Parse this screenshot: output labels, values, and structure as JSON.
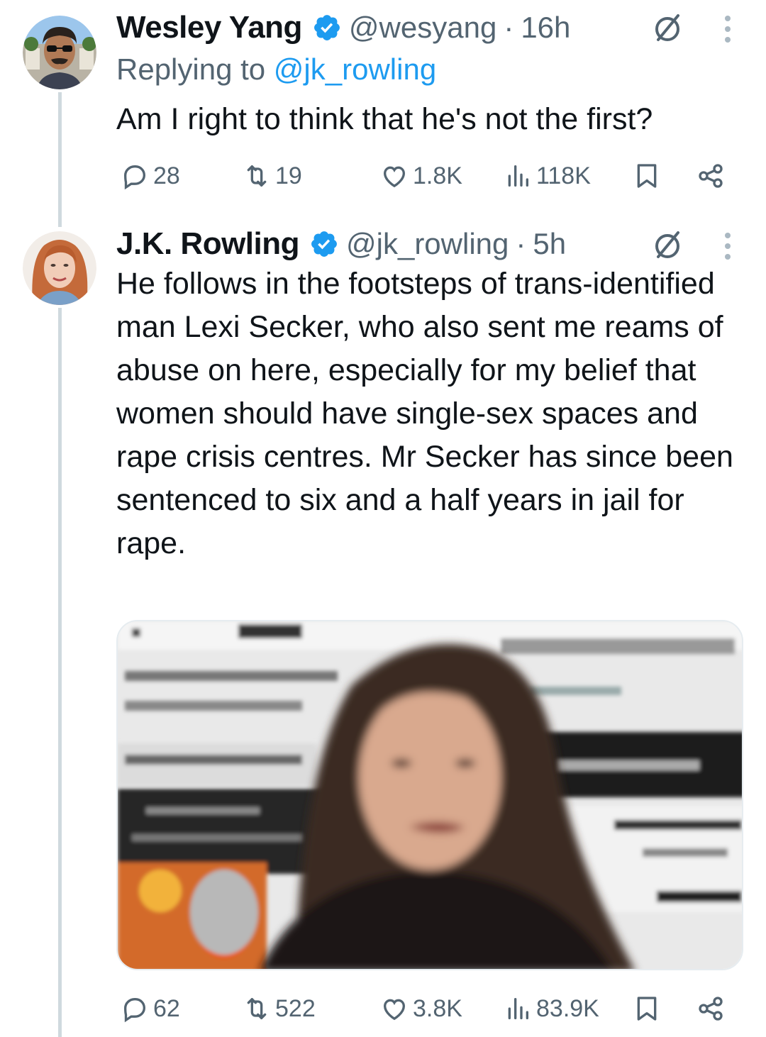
{
  "tweets": [
    {
      "name": "Wesley Yang",
      "handle": "@wesyang",
      "separator": "·",
      "time": "16h",
      "reply_prefix": "Replying to",
      "reply_mention": "@jk_rowling",
      "text": "Am I right to think that he's not the first?",
      "stats": {
        "replies": "28",
        "reposts": "19",
        "likes": "1.8K",
        "views": "118K"
      }
    },
    {
      "name": "J.K. Rowling",
      "handle": "@jk_rowling",
      "separator": "·",
      "time": "5h",
      "text": "He follows in the footsteps of trans-identified man Lexi Secker, who also sent me reams of abuse on here, especially for my belief that women should have single-sex spaces and rape crisis centres. Mr Secker has since been sentenced to six and a half years in jail for rape.",
      "stats": {
        "replies": "62",
        "reposts": "522",
        "likes": "3.8K",
        "views": "83.9K"
      }
    }
  ],
  "icons": [
    "verified-badge-icon",
    "grok-icon",
    "more-icon",
    "reply-icon",
    "repost-icon",
    "like-icon",
    "views-icon",
    "bookmark-icon",
    "share-icon"
  ],
  "colors": {
    "accent": "#1d9bf0",
    "muted": "#536471",
    "text": "#0f1419",
    "thread_line": "#cfd9de"
  }
}
